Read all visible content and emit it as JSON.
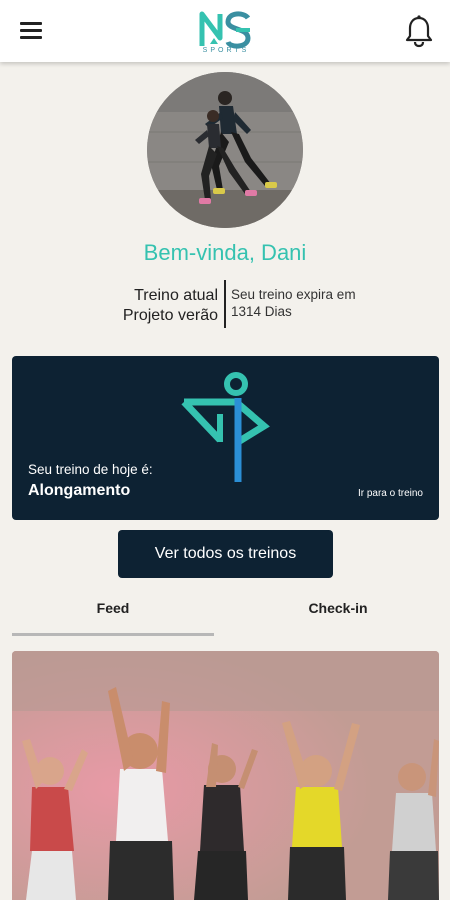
{
  "header": {
    "menu_icon": "hamburger-menu-icon",
    "logo_sub": "SPORTS",
    "notification_icon": "bell-icon",
    "colors": {
      "logo_teal": "#35c2b0",
      "logo_blue": "#3a8fa1"
    }
  },
  "profile": {
    "welcome": "Bem-vinda, Dani",
    "plan_label": "Treino atual",
    "plan_name": "Projeto verão",
    "expiry_label": "Seu treino expira em",
    "expiry_value": "1314 Dias"
  },
  "today_workout": {
    "label": "Seu treino de hoje é:",
    "value": "Alongamento",
    "link": "Ir para o treino",
    "icon": "stretching-figure-icon",
    "colors": {
      "card_bg": "#0d2233",
      "icon_teal": "#35c2b0",
      "icon_blue": "#2b8fd6"
    }
  },
  "actions": {
    "all_workouts": "Ver todos os treinos"
  },
  "tabs": [
    {
      "label": "Feed",
      "active": true
    },
    {
      "label": "Check-in",
      "active": false
    }
  ],
  "theme": {
    "background": "#f3f1ec",
    "accent": "#35c2b0",
    "dark": "#0d2233"
  }
}
